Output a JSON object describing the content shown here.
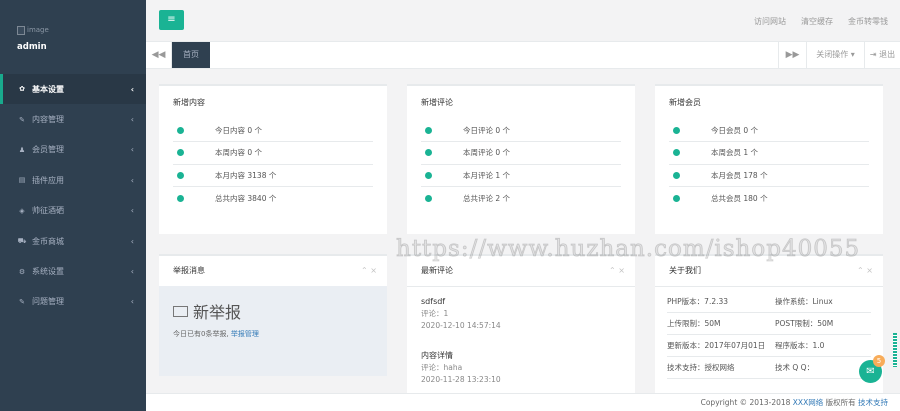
{
  "sidebar": {
    "profile_image_alt": "image",
    "username": "admin",
    "items": [
      {
        "icon": "gear-icon",
        "glyph": "✿",
        "label": "基本设置",
        "active": true
      },
      {
        "icon": "edit-icon",
        "glyph": "✎",
        "label": "内容管理"
      },
      {
        "icon": "user-icon",
        "glyph": "♟",
        "label": "会员管理"
      },
      {
        "icon": "book-icon",
        "glyph": "▤",
        "label": "插件应用"
      },
      {
        "icon": "cube-icon",
        "glyph": "◈",
        "label": "帅征酒硒"
      },
      {
        "icon": "cart-icon",
        "glyph": "⛟",
        "label": "金币商城"
      },
      {
        "icon": "cogs-icon",
        "glyph": "⚙",
        "label": "系统设置"
      },
      {
        "icon": "edit-icon",
        "glyph": "✎",
        "label": "问题管理"
      }
    ]
  },
  "header": {
    "menu_glyph": "≡",
    "links": [
      "访问网站",
      "清空缓存",
      "金币转零钱"
    ]
  },
  "tabs": {
    "left_arrow": "◀◀",
    "home": "首页",
    "right_arrow": "▶▶",
    "ops": "关闭操作 ▾",
    "logout": "⇥ 退出"
  },
  "stats": {
    "content": {
      "title": "新增内容",
      "rows": [
        "今日内容 0 个",
        "本周内容 0 个",
        "本月内容 3138 个",
        "总共内容 3840 个"
      ]
    },
    "comments": {
      "title": "新增评论",
      "rows": [
        "今日评论 0 个",
        "本周评论 0 个",
        "本月评论 1 个",
        "总共评论 2 个"
      ]
    },
    "members": {
      "title": "新增会员",
      "rows": [
        "今日会员 0 个",
        "本周会员 1 个",
        "本月会员 178 个",
        "总共会员 180 个"
      ]
    }
  },
  "report": {
    "title": "举报消息",
    "tools": "⌃ ×",
    "heading": "新举报",
    "text": "今日已有0条举报,",
    "link": "举报管理"
  },
  "latest_comments": {
    "title": "最新评论",
    "tools": "⌃ ×",
    "items": [
      {
        "title": "sdfsdf",
        "comment": "评论：1",
        "time": "2020-12-10 14:57:14"
      },
      {
        "title": "内容详情",
        "comment": "评论：haha",
        "time": "2020-11-28 13:23:10"
      }
    ]
  },
  "about": {
    "title": "关于我们",
    "tools": "⌃ ×",
    "rows": [
      [
        "PHP版本：7.2.33",
        "操作系统：Linux"
      ],
      [
        "上传限制：50M",
        "POST限制：50M"
      ],
      [
        "更新版本：2017年07月01日",
        "程序版本：1.0"
      ],
      [
        "技术支持：授权网络",
        "技术 Q Q："
      ]
    ]
  },
  "watermark": "https://www.huzhan.com/ishop40055",
  "footer": {
    "text": "Copyright © 2013-2018",
    "brand": "XXX网络",
    "rights": "版权所有",
    "support": "技术支持"
  },
  "chat": {
    "glyph": "✉",
    "badge": "5"
  },
  "colors": {
    "accent": "#1ab394",
    "sidebar": "#2f4050",
    "badge": "#f8ac59",
    "link": "#337ab7"
  }
}
